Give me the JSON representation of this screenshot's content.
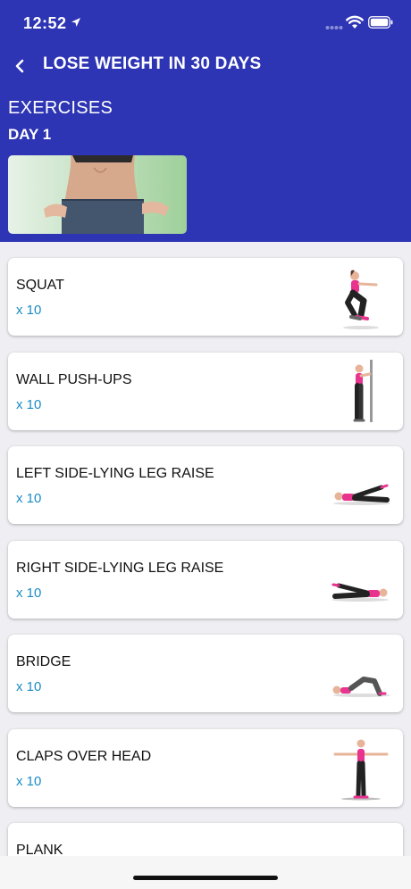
{
  "status": {
    "time": "12:52"
  },
  "nav": {
    "title": "LOSE WEIGHT IN 30 DAYS"
  },
  "section": {
    "title": "EXERCISES",
    "day": "DAY 1"
  },
  "exercises": [
    {
      "name": "SQUAT",
      "reps": "x 10",
      "icon": "squat-figure"
    },
    {
      "name": "WALL PUSH-UPS",
      "reps": "x 10",
      "icon": "wall-pushup-figure"
    },
    {
      "name": "LEFT SIDE-LYING LEG RAISE",
      "reps": "x 10",
      "icon": "left-leg-raise-figure"
    },
    {
      "name": "RIGHT SIDE-LYING LEG RAISE",
      "reps": "x 10",
      "icon": "right-leg-raise-figure"
    },
    {
      "name": "BRIDGE",
      "reps": "x 10",
      "icon": "bridge-figure"
    },
    {
      "name": "CLAPS OVER HEAD",
      "reps": "x 10",
      "icon": "claps-figure"
    },
    {
      "name": "PLANK",
      "reps": "",
      "icon": "plank-figure"
    }
  ],
  "colors": {
    "header": "#2e35b4",
    "reps": "#1a8cc4",
    "background": "#efeff3"
  }
}
